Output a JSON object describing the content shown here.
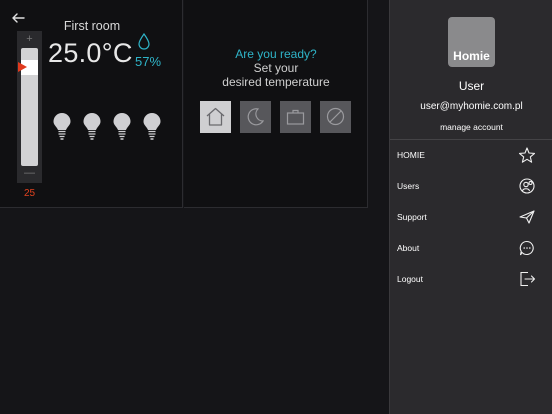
{
  "room": {
    "title": "First room",
    "temperature": "25.0°C",
    "humidity": "57%",
    "setpoint": "25",
    "slider": {
      "plus": "+",
      "minus": "—",
      "level": 0.88
    },
    "bulbs": [
      "bulb-1",
      "bulb-2",
      "bulb-3",
      "bulb-4"
    ]
  },
  "mode_panel": {
    "prompt": "Are you ready?",
    "line1": "Set your",
    "line2": "desired temperature",
    "modes": [
      {
        "name": "home",
        "icon": "home-icon",
        "active": true
      },
      {
        "name": "night",
        "icon": "moon-icon",
        "active": false
      },
      {
        "name": "work",
        "icon": "briefcase-icon",
        "active": false
      },
      {
        "name": "off",
        "icon": "disabled-icon",
        "active": false
      }
    ]
  },
  "drawer": {
    "logo": "Homie",
    "user_name": "User",
    "email": "user@myhomie.com.pl",
    "manage": "manage account",
    "menu": [
      {
        "label": "HOMIE",
        "icon": "star-icon"
      },
      {
        "label": "Users",
        "icon": "users-icon"
      },
      {
        "label": "Support",
        "icon": "paper-plane-icon"
      },
      {
        "label": "About",
        "icon": "chat-bubble-icon"
      },
      {
        "label": "Logout",
        "icon": "logout-icon"
      }
    ]
  },
  "colors": {
    "accent": "#2fb4c8",
    "setpoint": "#e0421f",
    "drawer_bg": "#2b2a2d",
    "panel_bg": "#101012"
  }
}
